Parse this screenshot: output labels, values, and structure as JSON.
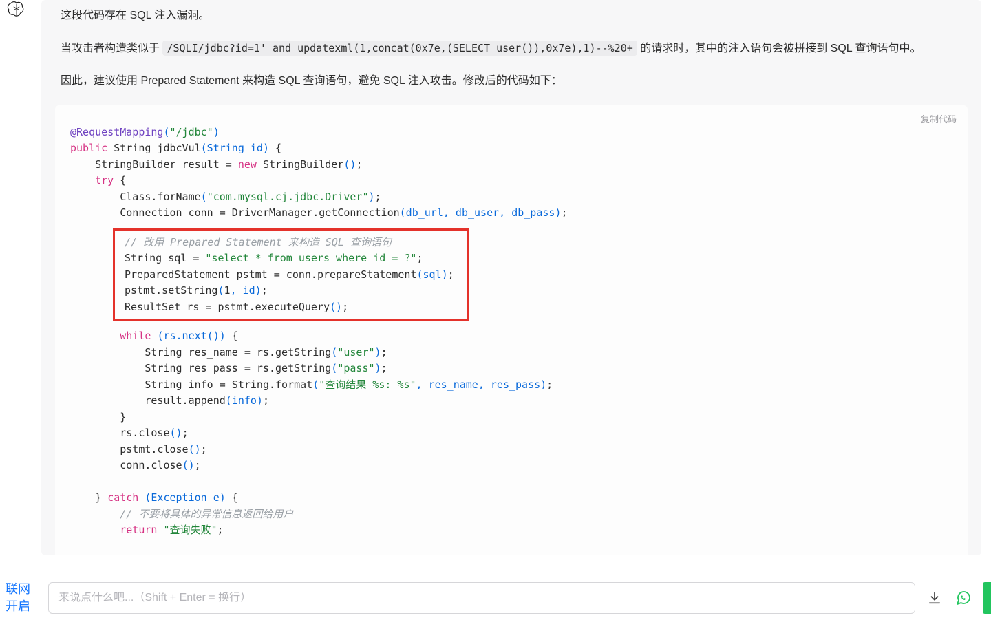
{
  "avatar_icon": "openai-knot-icon",
  "message": {
    "p1": "这段代码存在 SQL 注入漏洞。",
    "p2_pre": "当攻击者构造类似于 ",
    "p2_code": "/SQLI/jdbc?id=1' and updatexml(1,concat(0x7e,(SELECT user()),0x7e),1)--%20+",
    "p2_post": " 的请求时，其中的注入语句会被拼接到 SQL 查询语句中。",
    "p3": "因此，建议使用 Prepared Statement 来构造 SQL 查询语句，避免 SQL 注入攻击。修改后的代码如下："
  },
  "copy_label": "复制代码",
  "code": {
    "l01a": "@RequestMapping",
    "l01b": "(",
    "l01c": "\"/jdbc\"",
    "l01d": ")",
    "l02a": "public",
    "l02b": " String ",
    "l02c": "jdbcVul",
    "l02d": "(String id)",
    "l02e": " {",
    "l03a": "    StringBuilder result = ",
    "l03b": "new",
    "l03c": " StringBuilder",
    "l03d": "()",
    "l03e": ";",
    "l04a": "    ",
    "l04b": "try",
    "l04c": " {",
    "l05a": "        Class.forName",
    "l05b": "(",
    "l05c": "\"com.mysql.cj.jdbc.Driver\"",
    "l05d": ")",
    "l05e": ";",
    "l06a": "        Connection conn = DriverManager.getConnection",
    "l06b": "(db_url, db_user, db_pass)",
    "l06c": ";",
    "hl_comment": "// 改用 Prepared Statement 来构造 SQL 查询语句",
    "hl_l2a": "String sql = ",
    "hl_l2b": "\"select * from users where id = ?\"",
    "hl_l2c": ";",
    "hl_l3a": "PreparedStatement pstmt = conn.prepareStatement",
    "hl_l3b": "(sql)",
    "hl_l3c": ";",
    "hl_l4a": "pstmt.setString",
    "hl_l4b": "(",
    "hl_l4c": "1",
    "hl_l4d": ", id)",
    "hl_l4e": ";",
    "hl_l5a": "ResultSet rs = pstmt.executeQuery",
    "hl_l5b": "()",
    "hl_l5c": ";",
    "l08a": "        ",
    "l08b": "while",
    "l08c": " ",
    "l08d": "(rs.next",
    "l08e": "()",
    "l08f": ")",
    "l08g": " {",
    "l09a": "            String res_name = rs.getString",
    "l09b": "(",
    "l09c": "\"user\"",
    "l09d": ")",
    "l09e": ";",
    "l10a": "            String res_pass = rs.getString",
    "l10b": "(",
    "l10c": "\"pass\"",
    "l10d": ")",
    "l10e": ";",
    "l11a": "            String info = String.format",
    "l11b": "(",
    "l11c": "\"查询结果 %s: %s\"",
    "l11d": ", res_name, res_pass)",
    "l11e": ";",
    "l12a": "            result.append",
    "l12b": "(info)",
    "l12c": ";",
    "l13": "        }",
    "l14a": "        rs.close",
    "l14b": "()",
    "l14c": ";",
    "l15a": "        pstmt.close",
    "l15b": "()",
    "l15c": ";",
    "l16a": "        conn.close",
    "l16b": "()",
    "l16c": ";",
    "blank": "",
    "l17a": "    } ",
    "l17b": "catch",
    "l17c": " ",
    "l17d": "(Exception e)",
    "l17e": " {",
    "l18": "        // 不要将具体的异常信息返回给用户",
    "l19a": "        ",
    "l19b": "return",
    "l19c": " ",
    "l19d": "\"查询失败\"",
    "l19e": ";"
  },
  "footer": {
    "net_line1": "联网",
    "net_line2": "开启",
    "placeholder": "来说点什么吧...（Shift + Enter = 换行）"
  }
}
